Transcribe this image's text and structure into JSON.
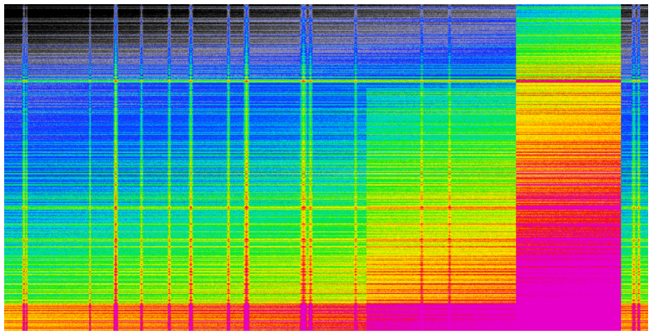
{
  "image": {
    "kind": "spectrogram",
    "colormap": [
      "#000000",
      "#808080",
      "#0000ff",
      "#00ffff",
      "#00ff00",
      "#ffff00",
      "#ff0000",
      "#ff00ff"
    ],
    "background": "#ffffff"
  }
}
